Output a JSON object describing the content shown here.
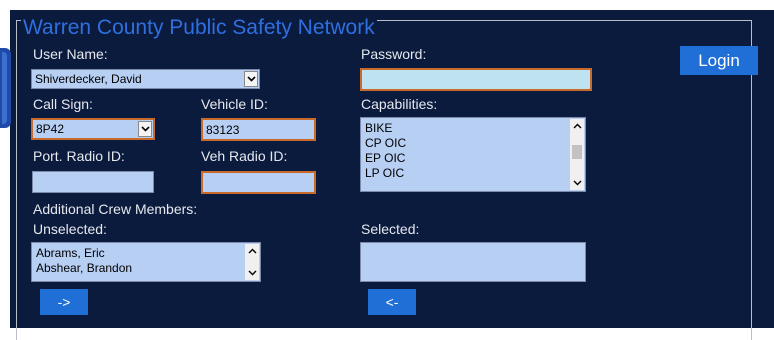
{
  "group": {
    "legend": "Warren County Public Safety Network"
  },
  "user_name": {
    "label": "User Name:",
    "value": "Shiverdecker, David"
  },
  "password": {
    "label": "Password:",
    "value": ""
  },
  "login_button": {
    "label": "Login"
  },
  "call_sign": {
    "label": "Call Sign:",
    "value": "8P42"
  },
  "vehicle_id": {
    "label": "Vehicle ID:",
    "value": "83123"
  },
  "capabilities": {
    "label": "Capabilities:",
    "items": [
      "BIKE",
      "CP OIC",
      "EP OIC",
      "LP OIC"
    ]
  },
  "port_radio_id": {
    "label": "Port. Radio ID:",
    "value": ""
  },
  "veh_radio_id": {
    "label": "Veh Radio ID:",
    "value": ""
  },
  "crew": {
    "label": "Additional Crew Members:",
    "unselected_label": "Unselected:",
    "unselected_items": [
      "Abrams, Eric",
      "Abshear, Brandon"
    ],
    "selected_label": "Selected:",
    "selected_items": [],
    "add_button": "->",
    "remove_button": "<-"
  },
  "colors": {
    "background": "#0b1b3d",
    "legend": "#2f6fe0",
    "field": "#b6cff3",
    "focus_border": "#c86a2c",
    "button": "#1f6fd6"
  }
}
